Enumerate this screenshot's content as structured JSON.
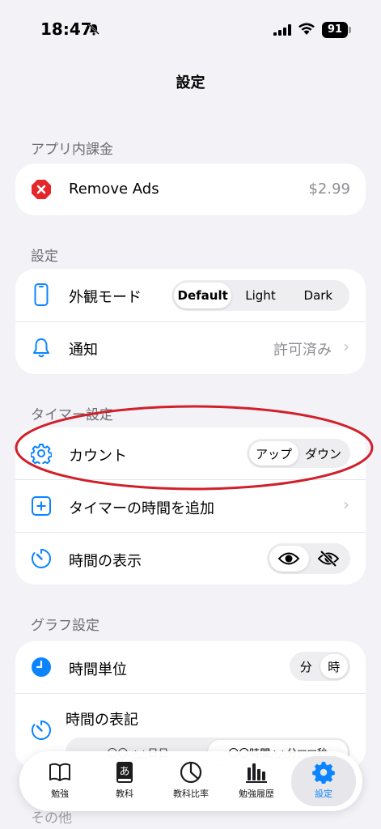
{
  "status": {
    "time": "18:47",
    "battery": "91"
  },
  "nav": {
    "title": "設定"
  },
  "sections": {
    "iap": {
      "header": "アプリ内課金",
      "remove_ads": {
        "label": "Remove Ads",
        "price": "$2.99"
      }
    },
    "settings": {
      "header": "設定",
      "appearance": {
        "label": "外観モード",
        "options": [
          "Default",
          "Light",
          "Dark"
        ],
        "selected": "Default"
      },
      "notify": {
        "label": "通知",
        "value": "許可済み"
      }
    },
    "timer": {
      "header": "タイマー設定",
      "count": {
        "label": "カウント",
        "options": [
          "アップ",
          "ダウン"
        ],
        "selected": "アップ"
      },
      "add_time": {
        "label": "タイマーの時間を追加"
      },
      "display": {
        "label": "時間の表示"
      }
    },
    "graph": {
      "header": "グラフ設定",
      "unit": {
        "label": "時間単位",
        "options": [
          "分",
          "時"
        ],
        "selected": "時"
      },
      "notation": {
        "label": "時間の表記",
        "options": [
          "〇〇.△△日日",
          "〇〇時間△△分□□秒"
        ]
      }
    },
    "other": {
      "header": "その他"
    }
  },
  "tabbar": {
    "items": [
      {
        "label": "勉強",
        "icon": "book-icon"
      },
      {
        "label": "教科",
        "icon": "dictionary-icon"
      },
      {
        "label": "教科比率",
        "icon": "pie-chart-icon"
      },
      {
        "label": "勉強履歴",
        "icon": "bar-chart-icon"
      },
      {
        "label": "設定",
        "icon": "gear-icon"
      }
    ],
    "active": "設定"
  },
  "colors": {
    "accent": "#0a84ff",
    "danger": "#e5262b",
    "annotation": "#d0202a"
  }
}
